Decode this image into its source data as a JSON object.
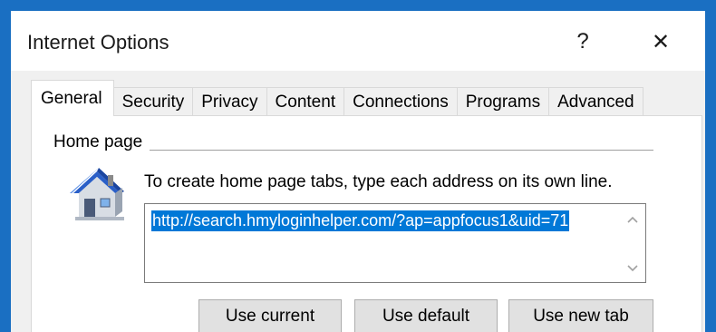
{
  "window": {
    "title": "Internet Options",
    "help_glyph": "?",
    "close_glyph": "✕"
  },
  "tabs": [
    {
      "label": "General",
      "active": true
    },
    {
      "label": "Security"
    },
    {
      "label": "Privacy"
    },
    {
      "label": "Content"
    },
    {
      "label": "Connections"
    },
    {
      "label": "Programs"
    },
    {
      "label": "Advanced"
    }
  ],
  "home_page": {
    "group_label": "Home page",
    "instruction": "To create home page tabs, type each address on its own line.",
    "url_value": "http://search.hmyloginhelper.com/?ap=appfocus1&uid=71",
    "icon": "house-icon",
    "buttons": {
      "use_current": "Use current",
      "use_default": "Use default",
      "use_new_tab": "Use new tab"
    }
  },
  "colors": {
    "selection": "#0078d7",
    "frame": "#1a6fc2",
    "house_roof": "#2a5fc8"
  }
}
